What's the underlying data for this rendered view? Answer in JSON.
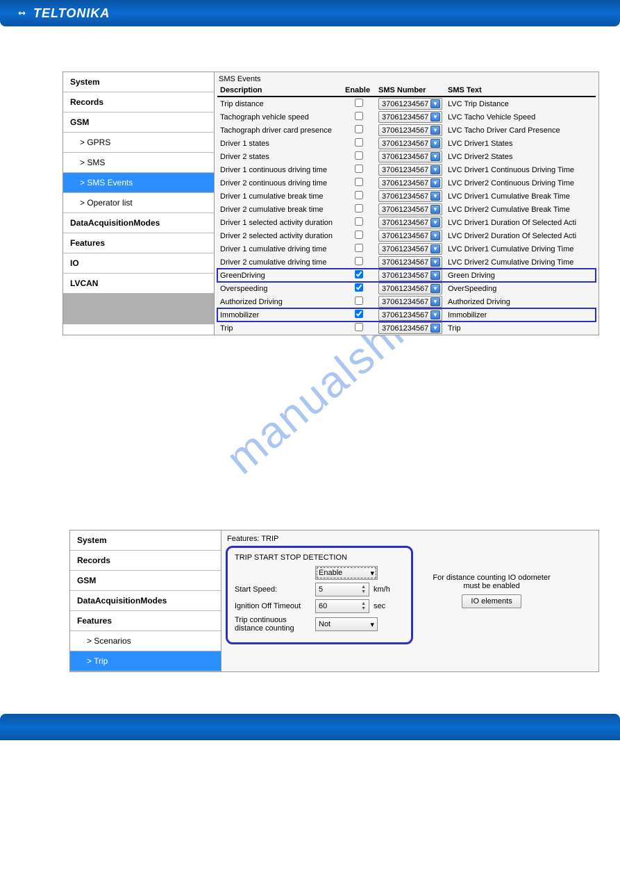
{
  "brand": "TELTONIKA",
  "watermark": "manualshive.co",
  "panel1": {
    "sidebar": [
      {
        "label": "System",
        "bold": true
      },
      {
        "label": "Records",
        "bold": true
      },
      {
        "label": "GSM",
        "bold": true
      },
      {
        "label": "> GPRS",
        "sub": true
      },
      {
        "label": "> SMS",
        "sub": true
      },
      {
        "label": "> SMS Events",
        "sub": true,
        "active": true
      },
      {
        "label": "> Operator list",
        "sub": true
      },
      {
        "label": "DataAcquisitionModes",
        "bold": true
      },
      {
        "label": "Features",
        "bold": true
      },
      {
        "label": "IO",
        "bold": true
      },
      {
        "label": "LVCAN",
        "bold": true
      }
    ],
    "section": "SMS Events",
    "headers": {
      "desc": "Description",
      "enable": "Enable",
      "num": "SMS Number",
      "text": "SMS Text"
    },
    "sms_number": "37061234567",
    "rows": [
      {
        "desc": "Trip distance",
        "checked": false,
        "text": "LVC Trip Distance"
      },
      {
        "desc": "Tachograph vehicle speed",
        "checked": false,
        "text": "LVC Tacho Vehicle Speed"
      },
      {
        "desc": "Tachograph driver card presence",
        "checked": false,
        "text": "LVC Tacho Driver Card Presence"
      },
      {
        "desc": "Driver 1 states",
        "checked": false,
        "text": "LVC Driver1 States"
      },
      {
        "desc": "Driver 2 states",
        "checked": false,
        "text": "LVC Driver2 States"
      },
      {
        "desc": "Driver 1 continuous driving time",
        "checked": false,
        "text": "LVC Driver1 Continuous Driving Time"
      },
      {
        "desc": "Driver 2 continuous driving time",
        "checked": false,
        "text": "LVC Driver2 Continuous Driving Time"
      },
      {
        "desc": "Driver 1 cumulative break time",
        "checked": false,
        "text": "LVC Driver1 Cumulative Break Time"
      },
      {
        "desc": "Driver 2 cumulative break time",
        "checked": false,
        "text": "LVC Driver2 Cumulative Break Time"
      },
      {
        "desc": "Driver 1 selected activity duration",
        "checked": false,
        "text": "LVC Driver1 Duration Of Selected Acti"
      },
      {
        "desc": "Driver 2 selected activity duration",
        "checked": false,
        "text": "LVC Driver2 Duration Of Selected Acti"
      },
      {
        "desc": "Driver 1 cumulative driving time",
        "checked": false,
        "text": "LVC Driver1 Cumulative Driving Time"
      },
      {
        "desc": "Driver 2 cumulative driving time",
        "checked": false,
        "text": "LVC Driver2 Cumulative Driving Time"
      },
      {
        "desc": "GreenDriving",
        "checked": true,
        "text": "Green Driving",
        "hl": true
      },
      {
        "desc": "Overspeeding",
        "checked": true,
        "text": "OverSpeeding"
      },
      {
        "desc": "Authorized Driving",
        "checked": false,
        "text": "Authorized Driving"
      },
      {
        "desc": "Immobilizer",
        "checked": true,
        "text": "Immobilizer",
        "hl": true
      },
      {
        "desc": "Trip",
        "checked": false,
        "text": "Trip"
      }
    ]
  },
  "panel2": {
    "sidebar": [
      {
        "label": "System",
        "bold": true
      },
      {
        "label": "Records",
        "bold": true
      },
      {
        "label": "GSM",
        "bold": true
      },
      {
        "label": "DataAcquisitionModes",
        "bold": true
      },
      {
        "label": "Features",
        "bold": true
      },
      {
        "label": "> Scenarios",
        "sub": true
      },
      {
        "label": "> Trip",
        "sub": true,
        "active": true
      }
    ],
    "section": "Features: TRIP",
    "box_title": "TRIP START STOP DETECTION",
    "mode_select": "Enable",
    "fields": {
      "start_speed": {
        "label": "Start Speed:",
        "value": "5",
        "unit": "km/h"
      },
      "ign_off": {
        "label": "Ignition Off Timeout",
        "value": "60",
        "unit": "sec"
      },
      "trip_cont": {
        "label": "Trip continuous distance counting",
        "value": "Not"
      }
    },
    "info_text": "For distance counting IO odometer must be enabled",
    "io_button": "IO elements"
  }
}
